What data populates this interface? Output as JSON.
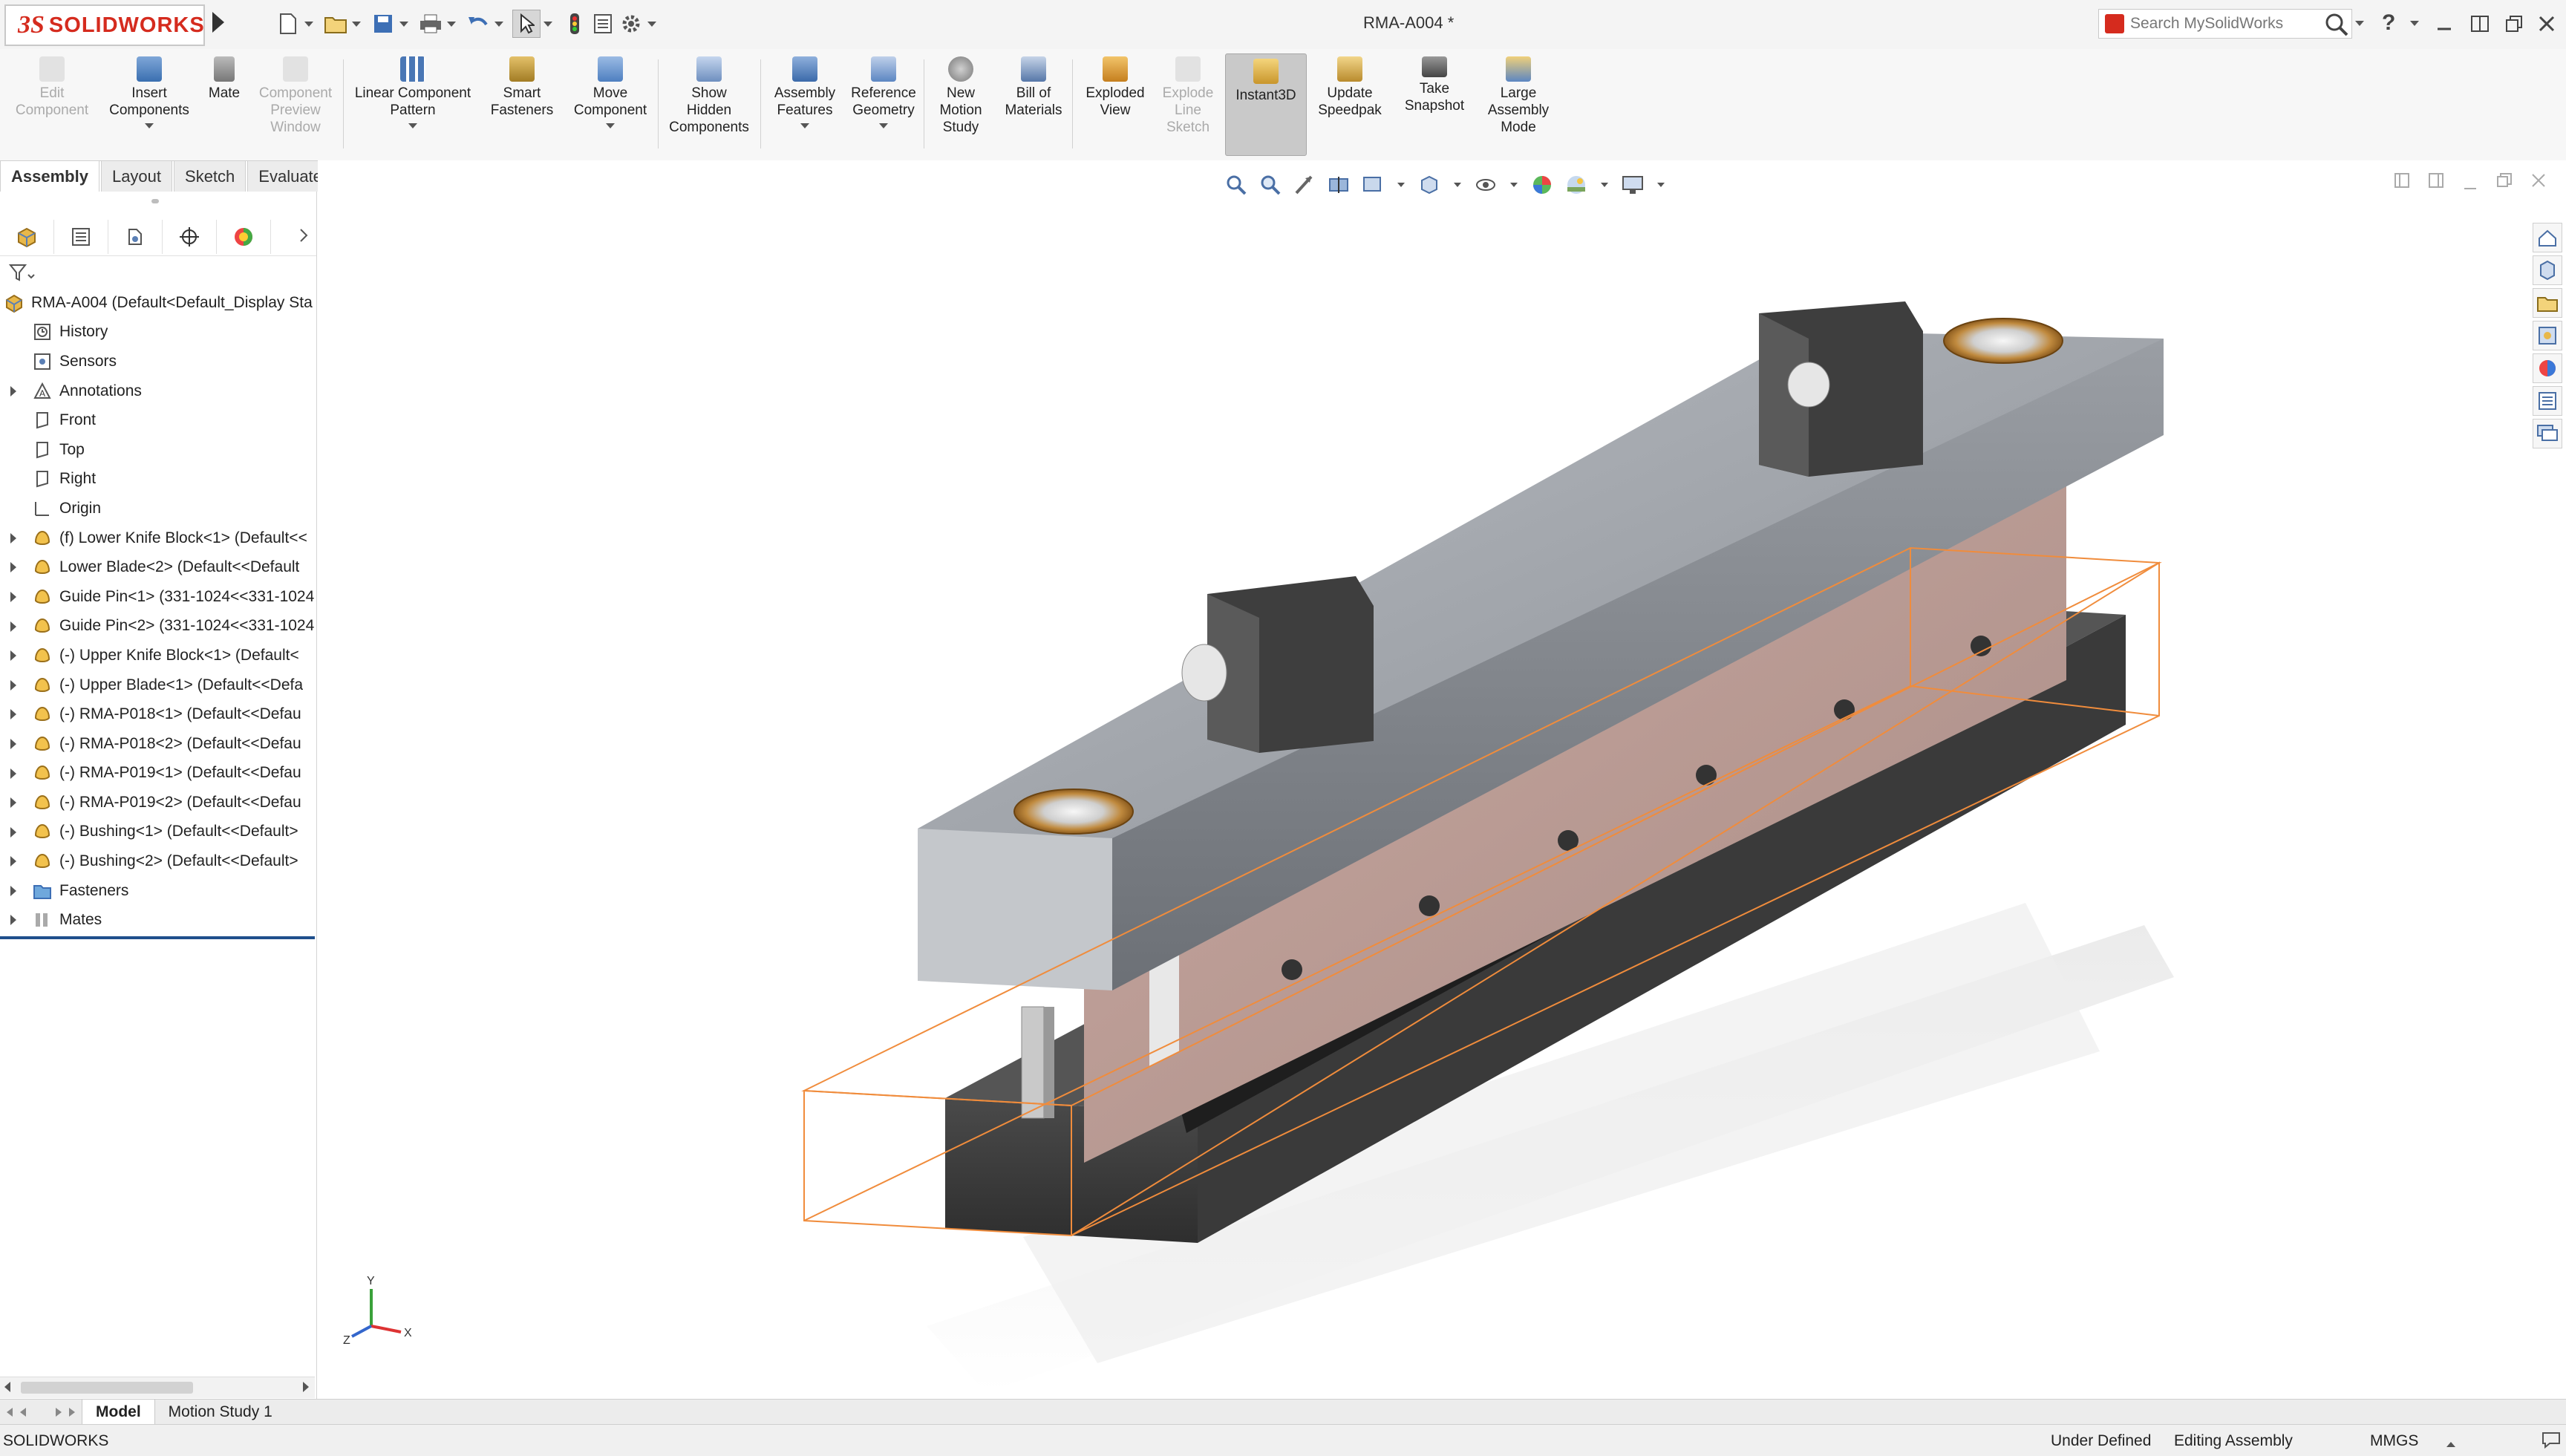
{
  "app": {
    "brand_prefix": "3S",
    "brand_name": "SOLIDWORKS",
    "document_title": "RMA-A004 *",
    "search_placeholder": "Search MySolidWorks",
    "help_symbol": "?"
  },
  "commands": [
    {
      "label": "Edit\nComponent",
      "enabled": false,
      "icon": "edit-component-icon"
    },
    {
      "label": "Insert\nComponents",
      "enabled": true,
      "icon": "insert-components-icon"
    },
    {
      "label": "Mate",
      "enabled": true,
      "icon": "mate-icon"
    },
    {
      "label": "Component\nPreview\nWindow",
      "enabled": false,
      "icon": "component-preview-icon"
    },
    {
      "label": "Linear Component\nPattern",
      "enabled": true,
      "icon": "linear-pattern-icon"
    },
    {
      "label": "Smart\nFasteners",
      "enabled": true,
      "icon": "smart-fasteners-icon"
    },
    {
      "label": "Move\nComponent",
      "enabled": true,
      "icon": "move-component-icon"
    },
    {
      "label": "Show\nHidden\nComponents",
      "enabled": true,
      "icon": "show-hidden-icon"
    },
    {
      "label": "Assembly\nFeatures",
      "enabled": true,
      "icon": "assembly-features-icon"
    },
    {
      "label": "Reference\nGeometry",
      "enabled": true,
      "icon": "reference-geometry-icon"
    },
    {
      "label": "New\nMotion\nStudy",
      "enabled": true,
      "icon": "motion-study-icon"
    },
    {
      "label": "Bill of\nMaterials",
      "enabled": true,
      "icon": "bom-icon"
    },
    {
      "label": "Exploded\nView",
      "enabled": true,
      "icon": "exploded-view-icon"
    },
    {
      "label": "Explode\nLine\nSketch",
      "enabled": false,
      "icon": "explode-line-icon"
    },
    {
      "label": "Instant3D",
      "enabled": true,
      "active": true,
      "icon": "instant3d-icon"
    },
    {
      "label": "Update\nSpeedpak",
      "enabled": true,
      "icon": "speedpak-icon"
    },
    {
      "label": "Take\nSnapshot",
      "enabled": true,
      "icon": "snapshot-icon"
    },
    {
      "label": "Large\nAssembly\nMode",
      "enabled": true,
      "icon": "large-assembly-icon"
    }
  ],
  "tabs": [
    "Assembly",
    "Layout",
    "Sketch",
    "Evaluate"
  ],
  "tree": {
    "root": "RMA-A004  (Default<Default_Display Sta",
    "items": [
      {
        "label": "History",
        "icon": "history-icon",
        "expandable": false
      },
      {
        "label": "Sensors",
        "icon": "sensors-icon",
        "expandable": false
      },
      {
        "label": "Annotations",
        "icon": "annotations-icon",
        "expandable": true
      },
      {
        "label": "Front",
        "icon": "plane-icon",
        "expandable": false
      },
      {
        "label": "Top",
        "icon": "plane-icon",
        "expandable": false
      },
      {
        "label": "Right",
        "icon": "plane-icon",
        "expandable": false
      },
      {
        "label": "Origin",
        "icon": "origin-icon",
        "expandable": false
      },
      {
        "label": "(f) Lower Knife Block<1> (Default<<",
        "icon": "part-icon",
        "expandable": true
      },
      {
        "label": "Lower Blade<2> (Default<<Default",
        "icon": "part-icon",
        "expandable": true
      },
      {
        "label": "Guide Pin<1> (331-1024<<331-1024",
        "icon": "part-icon",
        "expandable": true
      },
      {
        "label": "Guide Pin<2> (331-1024<<331-1024",
        "icon": "part-icon",
        "expandable": true
      },
      {
        "label": "(-) Upper Knife Block<1> (Default<",
        "icon": "part-icon",
        "expandable": true
      },
      {
        "label": "(-) Upper Blade<1> (Default<<Defa",
        "icon": "part-icon",
        "expandable": true
      },
      {
        "label": "(-) RMA-P018<1> (Default<<Defau",
        "icon": "part-icon",
        "expandable": true
      },
      {
        "label": "(-) RMA-P018<2> (Default<<Defau",
        "icon": "part-icon",
        "expandable": true
      },
      {
        "label": "(-) RMA-P019<1> (Default<<Defau",
        "icon": "part-icon",
        "expandable": true
      },
      {
        "label": "(-) RMA-P019<2> (Default<<Defau",
        "icon": "part-icon",
        "expandable": true
      },
      {
        "label": "(-) Bushing<1> (Default<<Default>",
        "icon": "part-icon",
        "expandable": true
      },
      {
        "label": "(-) Bushing<2> (Default<<Default>",
        "icon": "part-icon",
        "expandable": true
      },
      {
        "label": "Fasteners",
        "icon": "folder-icon",
        "expandable": true
      },
      {
        "label": "Mates",
        "icon": "mates-icon",
        "expandable": true
      }
    ]
  },
  "bottom_tabs": [
    "Model",
    "Motion Study 1"
  ],
  "status": {
    "app": "SOLIDWORKS",
    "definition": "Under Defined",
    "mode": "Editing Assembly",
    "units": "MMGS"
  },
  "triad": {
    "x": "X",
    "y": "Y",
    "z": "Z"
  },
  "colors": {
    "brand_red": "#d52b1e",
    "selection_orange": "#f08c3c",
    "tree_selected_line": "#1f4f8c"
  }
}
